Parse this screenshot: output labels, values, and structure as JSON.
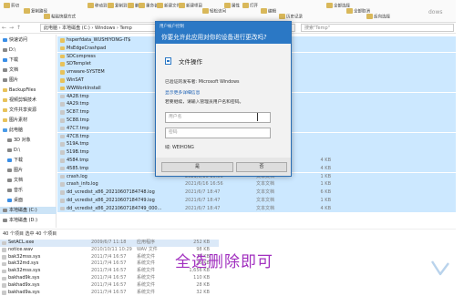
{
  "ribbon": {
    "items": [
      "剪切",
      "复制路径",
      "粘贴快捷方式",
      "移动到",
      "复制到",
      "删除",
      "重命名",
      "新建文件夹",
      "新建项目",
      "轻松访问",
      "属性",
      "打开",
      "编辑",
      "历史记录",
      "全部选择",
      "全部取消",
      "反向选择"
    ]
  },
  "address": {
    "path": "此电脑 › 本地磁盘 (C:) › Windows › Temp",
    "search_placeholder": "搜索\"Temp\"",
    "right_edge_text": "dows"
  },
  "sidebar": {
    "items": [
      "快速访问",
      "D:\\",
      "下载",
      "文档",
      "图片",
      "BackupFiles",
      "视频剪辑技术",
      "文件共享资源",
      "图片素材",
      "此电脑",
      "3D 对象",
      "D:\\",
      "下载",
      "图片",
      "文档",
      "音乐",
      "桌面",
      "本地磁盘 (C:)",
      "本地磁盘 (D:)"
    ]
  },
  "files": [
    {
      "name": "hsperfdata_WUSHIYONG-IT$",
      "date": "",
      "type": "",
      "size": ""
    },
    {
      "name": "MsEdgeCrashpad",
      "date": "",
      "type": "",
      "size": ""
    },
    {
      "name": "SDCompress",
      "date": "",
      "type": "",
      "size": ""
    },
    {
      "name": "SDTemplet",
      "date": "",
      "type": "",
      "size": ""
    },
    {
      "name": "vmware-SYSTEM",
      "date": "",
      "type": "",
      "size": ""
    },
    {
      "name": "WinSAT",
      "date": "",
      "type": "",
      "size": ""
    },
    {
      "name": "WWWorkInstall",
      "date": "",
      "type": "",
      "size": ""
    },
    {
      "name": "4A28.tmp",
      "date": "",
      "type": "",
      "size": ""
    },
    {
      "name": "4A29.tmp",
      "date": "",
      "type": "",
      "size": ""
    },
    {
      "name": "5C87.tmp",
      "date": "",
      "type": "",
      "size": ""
    },
    {
      "name": "5C88.tmp",
      "date": "",
      "type": "",
      "size": ""
    },
    {
      "name": "47C7.tmp",
      "date": "",
      "type": "",
      "size": ""
    },
    {
      "name": "47C8.tmp",
      "date": "",
      "type": "",
      "size": ""
    },
    {
      "name": "519A.tmp",
      "date": "",
      "type": "",
      "size": ""
    },
    {
      "name": "519B.tmp",
      "date": "",
      "type": "",
      "size": ""
    },
    {
      "name": "4584.tmp",
      "date": "2021/6/16 17:23",
      "type": "TMP 文件",
      "size": "4 KB"
    },
    {
      "name": "4585.tmp",
      "date": "2021/6/16 17:23",
      "type": "TMP 文件",
      "size": "4 KB"
    },
    {
      "name": "crash.log",
      "date": "2021/6/16 16:56",
      "type": "文本文档",
      "size": "1 KB"
    },
    {
      "name": "crash_info.log",
      "date": "2021/6/16 16:56",
      "type": "文本文档",
      "size": "1 KB"
    },
    {
      "name": "dd_vcredist_x86_20210607184748.log",
      "date": "2021/6/7 18:47",
      "type": "文本文档",
      "size": "6 KB"
    },
    {
      "name": "dd_vcredist_x86_20210607184749.log",
      "date": "2021/6/7 18:47",
      "type": "文本文档",
      "size": "1 KB"
    },
    {
      "name": "dd_vcredist_x86_20210607184749_000...",
      "date": "2021/6/7 18:47",
      "type": "文本文档",
      "size": "4 KB"
    }
  ],
  "status": "40 个项目    选中 40 个项目",
  "bottom_files": [
    {
      "name": "SetACL.exe",
      "date": "2009/6/7 11:18",
      "type": "应用程序",
      "size": "252 KB"
    },
    {
      "name": "notice.wav",
      "date": "2010/10/11 10:29",
      "type": "WAV 文件",
      "size": "98 KB"
    },
    {
      "name": "bak32mss.sys",
      "date": "2011/7/4 16:57",
      "type": "系统文件",
      "size": "25 KB"
    },
    {
      "name": "bak32md.sys",
      "date": "2011/7/4 16:57",
      "type": "系统文件",
      "size": "25 KB"
    },
    {
      "name": "bak32mss.sys",
      "date": "2011/7/4 16:57",
      "type": "系统文件",
      "size": "1,656 KB"
    },
    {
      "name": "bakhad9k.sys",
      "date": "2011/7/4 16:57",
      "type": "系统文件",
      "size": "110 KB"
    },
    {
      "name": "bakhad9x.sys",
      "date": "2011/7/4 16:57",
      "type": "系统文件",
      "size": "28 KB"
    },
    {
      "name": "bakhad9a.sys",
      "date": "2011/7/4 16:57",
      "type": "系统文件",
      "size": "32 KB"
    }
  ],
  "caption": "全选删除即可",
  "uac": {
    "window_title": "用户帐户控制",
    "question": "你要允许此应用对你的设备进行更改吗?",
    "app_name": "文件操作",
    "publisher": "已验证的发布者: Microsoft Windows",
    "details_link": "显示更多详细信息",
    "instruction": "若要继续，请输入管理员用户名和密码。",
    "username_placeholder": "用户名",
    "password_placeholder": "密码",
    "domain": "域: WEIHONG",
    "yes": "是",
    "no": "否"
  },
  "colors": {
    "accent": "#2b78c5",
    "folder": "#e8c25a",
    "caption": "#a12fbf",
    "selection": "#cce8ff"
  }
}
